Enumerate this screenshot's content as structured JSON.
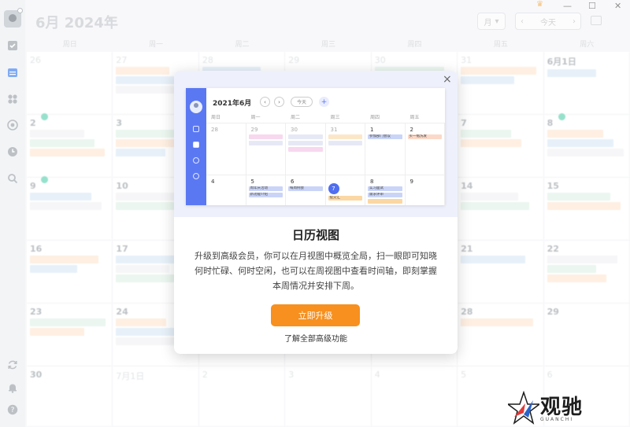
{
  "header": {
    "title": "6月 2024年",
    "view_label": "月",
    "today_label": "今天"
  },
  "weekdays": [
    "周日",
    "周一",
    "周二",
    "周三",
    "周四",
    "周五",
    "周六"
  ],
  "calendar": {
    "cells": [
      {
        "day": "26",
        "dim": true
      },
      {
        "day": "27",
        "dim": true
      },
      {
        "day": "28",
        "dim": true
      },
      {
        "day": "29",
        "dim": true
      },
      {
        "day": "30",
        "dim": true
      },
      {
        "day": "31",
        "dim": true
      },
      {
        "day": "6月1日",
        "dim": false
      },
      {
        "day": "2",
        "dim": false
      },
      {
        "day": "3",
        "dim": false
      },
      {
        "day": "4",
        "dim": false
      },
      {
        "day": "5",
        "dim": false
      },
      {
        "day": "6",
        "dim": false
      },
      {
        "day": "7",
        "dim": false
      },
      {
        "day": "8",
        "dim": false
      },
      {
        "day": "9",
        "dim": false
      },
      {
        "day": "10",
        "dim": false
      },
      {
        "day": "11",
        "dim": false
      },
      {
        "day": "12",
        "dim": false
      },
      {
        "day": "13",
        "dim": false
      },
      {
        "day": "14",
        "dim": false
      },
      {
        "day": "15",
        "dim": false
      },
      {
        "day": "16",
        "dim": false
      },
      {
        "day": "17",
        "dim": false
      },
      {
        "day": "18",
        "dim": false
      },
      {
        "day": "19",
        "dim": false
      },
      {
        "day": "20",
        "dim": false
      },
      {
        "day": "21",
        "dim": false
      },
      {
        "day": "22",
        "dim": false
      },
      {
        "day": "23",
        "dim": false
      },
      {
        "day": "24",
        "dim": false
      },
      {
        "day": "25",
        "dim": false
      },
      {
        "day": "26",
        "dim": false
      },
      {
        "day": "27",
        "dim": false
      },
      {
        "day": "28",
        "dim": false
      },
      {
        "day": "29",
        "dim": false
      },
      {
        "day": "30",
        "dim": false
      },
      {
        "day": "7月1日",
        "dim": true
      },
      {
        "day": "2",
        "dim": true
      },
      {
        "day": "3",
        "dim": true
      },
      {
        "day": "4",
        "dim": true
      },
      {
        "day": "5",
        "dim": true
      },
      {
        "day": "6",
        "dim": true
      }
    ]
  },
  "modal": {
    "close_label": "×",
    "heading": "日历视图",
    "description": "升级到高级会员，你可以在月视图中概览全局，扫一眼即可知晓何时忙碌、何时空闲，也可以在周视图中查看时间轴，即刻掌握本周情况并安排下周。",
    "upgrade_label": "立即升级",
    "learn_more_label": "了解全部高级功能",
    "preview": {
      "title": "2021年6月",
      "today_label": "今天",
      "weekdays": [
        "周日",
        "周一",
        "周二",
        "周三",
        "周四",
        "周五"
      ],
      "days": [
        "28",
        "29",
        "30",
        "31",
        "1",
        "2",
        "4",
        "5",
        "6",
        "7",
        "8",
        "9"
      ],
      "events": {
        "e1": "参加部门会议",
        "e2": "买一瓶洗发",
        "e3": "周年庆活动",
        "e4": "新功能介绍",
        "e5": "每周例会",
        "e6": "提交汇",
        "e7": "实习面试",
        "e8": "需求评审"
      }
    }
  },
  "watermark": {
    "text": "观驰",
    "sub": "GUANCHI"
  }
}
